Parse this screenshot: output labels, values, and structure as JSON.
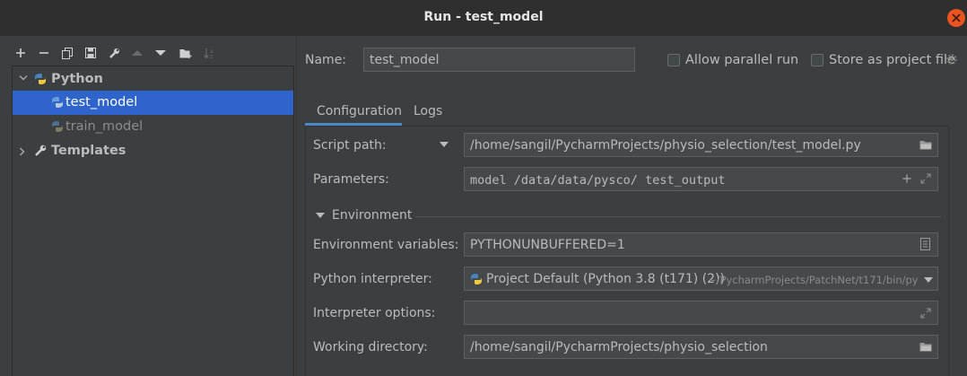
{
  "window": {
    "title": "Run - test_model"
  },
  "toolbar": {
    "icons": [
      "add-icon",
      "remove-icon",
      "copy-icon",
      "save-icon",
      "wrench-icon",
      "move-up-icon",
      "move-down-icon",
      "folder-add-icon",
      "sort-icon"
    ]
  },
  "tree": {
    "python": {
      "label": "Python",
      "children": [
        {
          "label": "test_model",
          "selected": true
        },
        {
          "label": "train_model",
          "selected": false
        }
      ]
    },
    "templates": {
      "label": "Templates"
    }
  },
  "form": {
    "name_label": "Name:",
    "name_value": "test_model",
    "allow_parallel_label": "Allow parallel run",
    "allow_parallel_checked": false,
    "store_project_label": "Store as project file",
    "store_project_checked": false,
    "tabs": [
      "Configuration",
      "Logs"
    ],
    "active_tab": "Configuration",
    "script_path_label": "Script path:",
    "script_path_value": "/home/sangil/PycharmProjects/physio_selection/test_model.py",
    "parameters_label": "Parameters:",
    "parameters_value": "model /data/data/pysco/ test_output",
    "environment_section": "Environment",
    "env_vars_label": "Environment variables:",
    "env_vars_value": "PYTHONUNBUFFERED=1",
    "interpreter_label": "Python interpreter:",
    "interpreter_value": "Project Default (Python 3.8 (t171) (2))",
    "interpreter_path": "~/PycharmProjects/PatchNet/t171/bin/py",
    "interp_options_label": "Interpreter options:",
    "interp_options_value": "",
    "working_dir_label": "Working directory:",
    "working_dir_value": "/home/sangil/PycharmProjects/physio_selection"
  },
  "colors": {
    "selection": "#2f65ca",
    "close_button": "#e95420",
    "tab_underline": "#4a88c7",
    "background": "#3c3f41"
  }
}
